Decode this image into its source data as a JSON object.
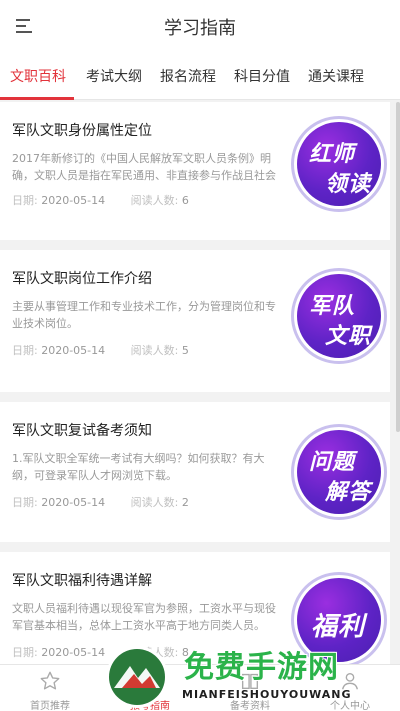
{
  "header": {
    "title": "学习指南"
  },
  "tabs": [
    {
      "label": "文职百科"
    },
    {
      "label": "考试大纲"
    },
    {
      "label": "报名流程"
    },
    {
      "label": "科目分值"
    },
    {
      "label": "通关课程"
    }
  ],
  "cards": [
    {
      "title": "军队文职身份属性定位",
      "desc": "2017年新修订的《中国人民解放军文职人员条例》明确，文职人员是指在军民通用、非直接参与作战且社会",
      "date_label": "日期:",
      "date": "2020-05-14",
      "reads_label": "阅读人数:",
      "reads": "6",
      "badge_line1": "红师",
      "badge_line2": "领读"
    },
    {
      "title": "军队文职岗位工作介绍",
      "desc": "主要从事管理工作和专业技术工作，分为管理岗位和专业技术岗位。",
      "date_label": "日期:",
      "date": "2020-05-14",
      "reads_label": "阅读人数:",
      "reads": "5",
      "badge_line1": "军队",
      "badge_line2": "文职"
    },
    {
      "title": "军队文职复试备考须知",
      "desc": "1.军队文职全军统一考试有大纲吗？如何获取？有大纲，可登录军队人才网浏览下载。",
      "date_label": "日期:",
      "date": "2020-05-14",
      "reads_label": "阅读人数:",
      "reads": "2",
      "badge_line1": "问题",
      "badge_line2": "解答"
    },
    {
      "title": "军队文职福利待遇详解",
      "desc": "文职人员福利待遇以现役军官为参照，工资水平与现役军官基本相当，总体上工资水平高于地方同类人员。",
      "date_label": "日期:",
      "date": "2020-05-14",
      "reads_label": "阅读人数:",
      "reads": "8",
      "badge_line1": "福利",
      "badge_line2": ""
    }
  ],
  "bottom_nav": [
    {
      "label": "首页推荐",
      "icon": "star-icon"
    },
    {
      "label": "报考指南",
      "icon": "guide-icon"
    },
    {
      "label": "备考资料",
      "icon": "book-icon"
    },
    {
      "label": "个人中心",
      "icon": "user-icon"
    }
  ],
  "watermark": {
    "cn": "免费手游网",
    "en": "MIANFEISHOUYOUWANG"
  },
  "colors": {
    "accent": "#e2333b",
    "badge": "#5e23c6",
    "watermark": "#2bb34a"
  }
}
